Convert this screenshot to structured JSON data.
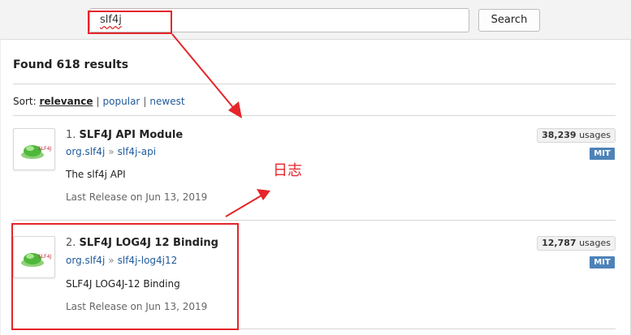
{
  "search": {
    "query": "slf4j",
    "button_label": "Search"
  },
  "results": {
    "count_label": "Found 618 results",
    "sort": {
      "label": "Sort:",
      "options": [
        "relevance",
        "popular",
        "newest"
      ],
      "active": "relevance"
    },
    "items": [
      {
        "index": "1.",
        "title": "SLF4J API Module",
        "group": "org.slf4j",
        "artifact": "slf4j-api",
        "description": "The slf4j API",
        "release": "Last Release on Jun 13, 2019",
        "usages_count": "38,239",
        "usages_label": "usages",
        "license": "MIT",
        "logo_text": "SLF4J"
      },
      {
        "index": "2.",
        "title": "SLF4J LOG4J 12 Binding",
        "group": "org.slf4j",
        "artifact": "slf4j-log4j12",
        "description": "SLF4J LOG4J-12 Binding",
        "release": "Last Release on Jun 13, 2019",
        "usages_count": "12,787",
        "usages_label": "usages",
        "license": "MIT",
        "logo_text": "SLF4J"
      }
    ]
  },
  "annotation": {
    "note": "日志",
    "color": "#e5252a"
  },
  "colors": {
    "link": "#1f5a9a",
    "license_badge": "#4d82b8",
    "annotation_red": "#e5252a"
  }
}
